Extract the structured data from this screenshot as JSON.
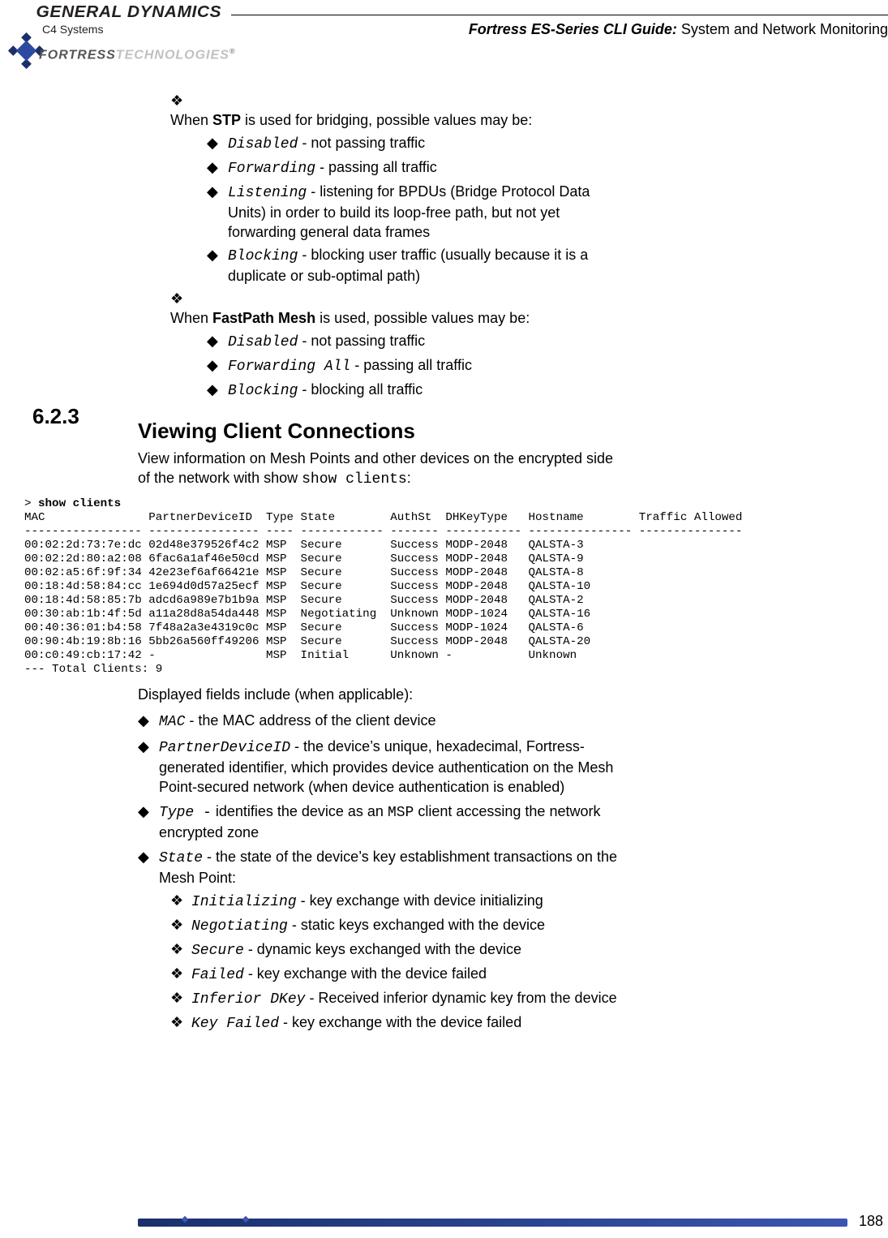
{
  "header": {
    "company": "GENERAL DYNAMICS",
    "company_sub": "C4 Systems",
    "brand_fortress": "FORTRESS",
    "brand_tech": "TECHNOLOGIES",
    "brand_reg": "®",
    "guide_em": "Fortress ES-Series CLI Guide:",
    "guide_rest": " System and Network Monitoring"
  },
  "stp_intro": "When ",
  "stp_bold": "STP",
  "stp_rest": " is used for bridging, possible values may be:",
  "stp_items": [
    {
      "code": "Disabled",
      "text": " - not passing traffic"
    },
    {
      "code": "Forwarding",
      "text": " - passing all traffic"
    },
    {
      "code": "Listening",
      "text": " - listening for BPDUs (Bridge Protocol Data Units) in order to build its loop-free path, but not yet forwarding general data frames"
    },
    {
      "code": "Blocking",
      "text": " - blocking user traffic (usually because it is a duplicate or sub-optimal path)"
    }
  ],
  "fpm_intro": "When ",
  "fpm_bold": "FastPath Mesh",
  "fpm_rest": " is used, possible values may be:",
  "fpm_items": [
    {
      "code": "Disabled",
      "text": " - not passing traffic"
    },
    {
      "code": "Forwarding All",
      "text": "  - passing all traffic"
    },
    {
      "code": "Blocking",
      "text": " - blocking all traffic"
    }
  ],
  "section": {
    "num": "6.2.3",
    "title": "Viewing Client Connections",
    "para_a": "View information on Mesh Points and other devices on the encrypted side of the network with show ",
    "para_cmd": "show clients",
    "para_b": ":"
  },
  "cli": {
    "prompt": "> ",
    "cmd": "show clients",
    "lines": [
      "MAC               PartnerDeviceID  Type State        AuthSt  DHKeyType   Hostname        Traffic Allowed",
      "----------------- ---------------- ---- ------------ ------- ----------- --------------- ---------------",
      "00:02:2d:73:7e:dc 02d48e379526f4c2 MSP  Secure       Success MODP-2048   QALSTA-3",
      "00:02:2d:80:a2:08 6fac6a1af46e50cd MSP  Secure       Success MODP-2048   QALSTA-9",
      "00:02:a5:6f:9f:34 42e23ef6af66421e MSP  Secure       Success MODP-2048   QALSTA-8",
      "00:18:4d:58:84:cc 1e694d0d57a25ecf MSP  Secure       Success MODP-2048   QALSTA-10",
      "00:18:4d:58:85:7b adcd6a989e7b1b9a MSP  Secure       Success MODP-2048   QALSTA-2",
      "00:30:ab:1b:4f:5d a11a28d8a54da448 MSP  Negotiating  Unknown MODP-1024   QALSTA-16",
      "00:40:36:01:b4:58 7f48a2a3e4319c0c MSP  Secure       Success MODP-1024   QALSTA-6",
      "00:90:4b:19:8b:16 5bb26a560ff49206 MSP  Secure       Success MODP-2048   QALSTA-20",
      "00:c0:49:cb:17:42 -                MSP  Initial      Unknown -           Unknown",
      "--- Total Clients: 9"
    ]
  },
  "fields_intro": "Displayed fields include (when applicable):",
  "fields": [
    {
      "code": "MAC",
      "text": " - the MAC address of the client device"
    },
    {
      "code": "PartnerDeviceID",
      "text": " - the device’s unique, hexadecimal, Fortress-generated identifier, which provides device authentication on the Mesh Point-secured network (when device authentication is enabled)"
    },
    {
      "code": "Type -",
      "text_pre": " identifies the device as an ",
      "text_code2": "MSP",
      "text_post": " client accessing the network encrypted zone"
    },
    {
      "code": "State",
      "text": " - the state of the device’s key establishment transactions on the Mesh Point:"
    }
  ],
  "state_sub": [
    {
      "code": "Initializing",
      "text": " - key exchange with device initializing"
    },
    {
      "code": "Negotiating",
      "text": " - static keys exchanged with the device"
    },
    {
      "code": "Secure",
      "text": " - dynamic keys exchanged with the device"
    },
    {
      "code": "Failed",
      "text": " - key exchange with the device failed"
    },
    {
      "code": "Inferior DKey",
      "text": " - Received inferior dynamic key from the device"
    },
    {
      "code": "Key Failed",
      "text": " - key exchange with the device failed"
    }
  ],
  "page_no": "188"
}
